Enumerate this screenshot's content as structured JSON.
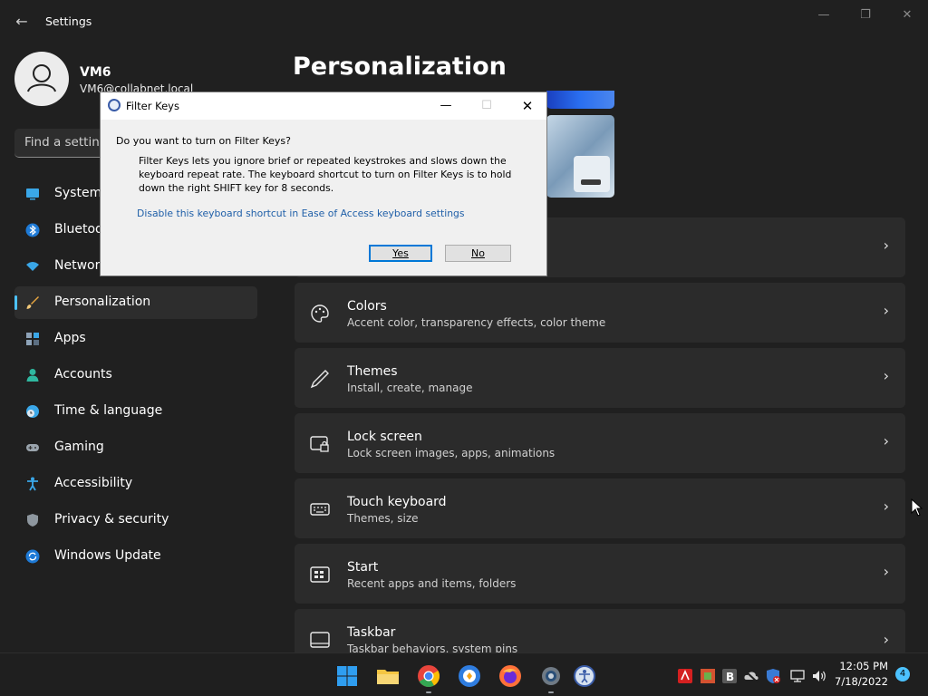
{
  "window": {
    "app_title": "Settings",
    "back_icon": "←",
    "minimize_icon": "—",
    "maximize_icon": "❐",
    "close_icon": "✕"
  },
  "profile": {
    "name": "VM6",
    "email": "VM6@collabnet.local"
  },
  "search": {
    "placeholder": "Find a setting"
  },
  "sidebar": {
    "items": [
      {
        "label": "System",
        "icon": "monitor-icon"
      },
      {
        "label": "Bluetooth & devices",
        "icon": "bluetooth-icon"
      },
      {
        "label": "Network & internet",
        "icon": "wifi-icon"
      },
      {
        "label": "Personalization",
        "icon": "brush-icon",
        "active": true
      },
      {
        "label": "Apps",
        "icon": "apps-icon"
      },
      {
        "label": "Accounts",
        "icon": "person-icon"
      },
      {
        "label": "Time & language",
        "icon": "globe-clock-icon"
      },
      {
        "label": "Gaming",
        "icon": "gamepad-icon"
      },
      {
        "label": "Accessibility",
        "icon": "accessibility-icon"
      },
      {
        "label": "Privacy & security",
        "icon": "shield-icon"
      },
      {
        "label": "Windows Update",
        "icon": "update-icon"
      }
    ]
  },
  "main": {
    "title": "Personalization",
    "cards": [
      {
        "title": "Colors",
        "subtitle": "Accent color, transparency effects, color theme",
        "icon": "palette-icon"
      },
      {
        "title": "Themes",
        "subtitle": "Install, create, manage",
        "icon": "pen-icon"
      },
      {
        "title": "Lock screen",
        "subtitle": "Lock screen images, apps, animations",
        "icon": "lock-screen-icon"
      },
      {
        "title": "Touch keyboard",
        "subtitle": "Themes, size",
        "icon": "keyboard-icon"
      },
      {
        "title": "Start",
        "subtitle": "Recent apps and items, folders",
        "icon": "start-icon"
      },
      {
        "title": "Taskbar",
        "subtitle": "Taskbar behaviors, system pins",
        "icon": "taskbar-icon"
      }
    ],
    "chevron": "›"
  },
  "dialog": {
    "title": "Filter Keys",
    "question": "Do you want to turn on Filter Keys?",
    "body": "Filter Keys lets you ignore brief or repeated keystrokes and slows down the keyboard repeat rate.  The keyboard shortcut to turn on Filter Keys is to hold down the right SHIFT key for 8 seconds.",
    "link": "Disable this keyboard shortcut in Ease of Access keyboard settings",
    "yes_label": "Yes",
    "no_label": "No",
    "minimize_icon": "—",
    "maximize_icon": "☐",
    "close_icon": "✕"
  },
  "taskbar": {
    "time": "12:05 PM",
    "date": "7/18/2022",
    "notification_count": "4",
    "apps": [
      "windows-start-icon",
      "file-explorer-icon",
      "chrome-icon",
      "brave-icon",
      "firefox-icon",
      "settings-gear-icon",
      "accessibility-app-icon"
    ],
    "tray": [
      "avira-icon",
      "office-icon",
      "b-app-icon",
      "cloud-offline-icon",
      "defender-icon",
      "network-icon",
      "volume-icon"
    ]
  },
  "colors": {
    "accent": "#4cc2ff",
    "background": "#202020",
    "card": "#2b2b2b",
    "link": "#1f5fa8"
  }
}
